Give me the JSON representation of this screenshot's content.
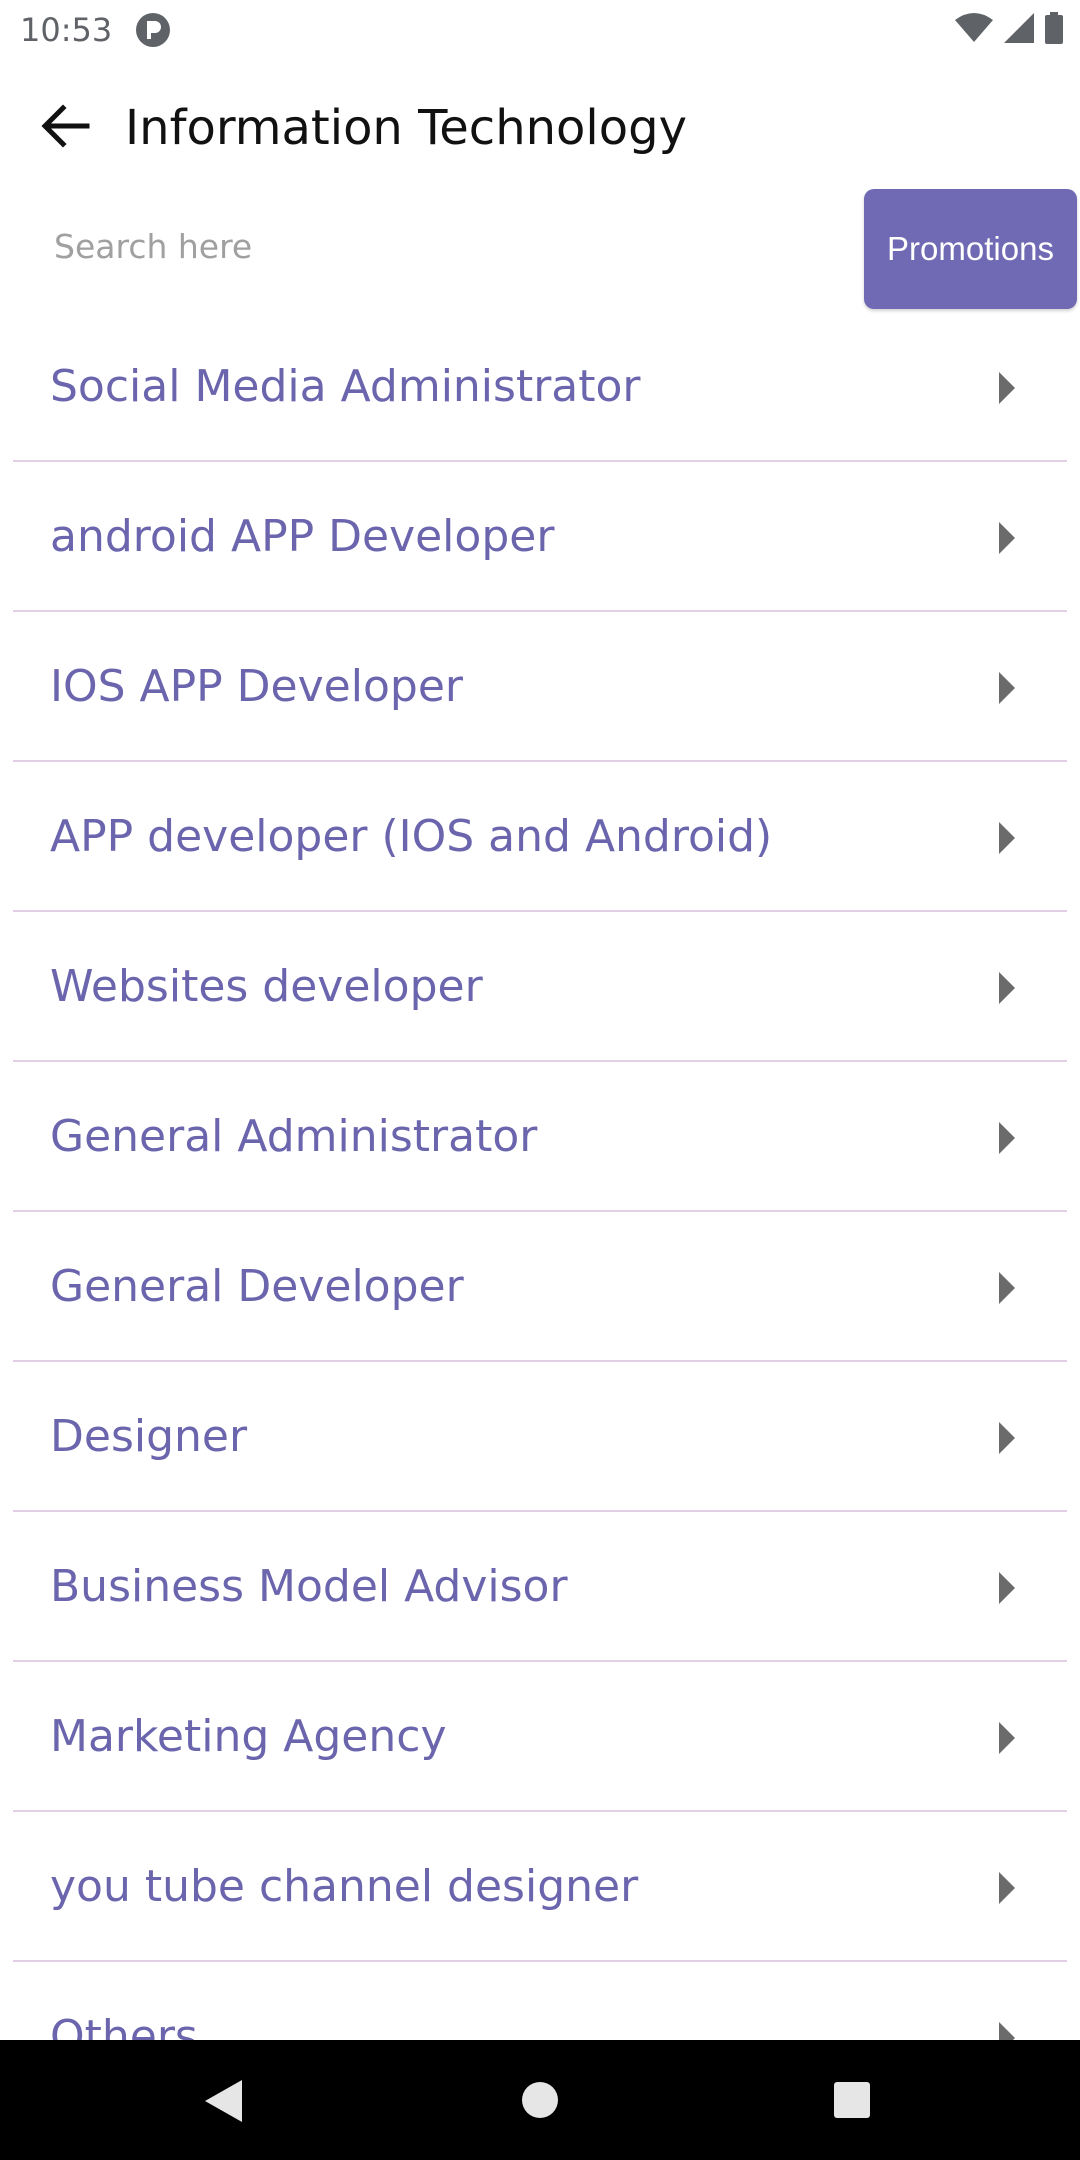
{
  "status_bar": {
    "time": "10:53",
    "app_icon": "circle-p-icon",
    "icons": [
      "wifi-icon",
      "signal-icon",
      "battery-icon"
    ]
  },
  "app_bar": {
    "title": "Information Technology",
    "back_icon": "arrow-back-icon"
  },
  "search": {
    "placeholder": "Search here",
    "value": ""
  },
  "promotions": {
    "label": "Promotions"
  },
  "list": {
    "items": [
      {
        "label": "Social Media Administrator"
      },
      {
        "label": "android APP Developer"
      },
      {
        "label": "IOS APP Developer"
      },
      {
        "label": "APP developer (IOS and Android)"
      },
      {
        "label": "Websites developer"
      },
      {
        "label": "General Administrator"
      },
      {
        "label": "General Developer"
      },
      {
        "label": "Designer"
      },
      {
        "label": "Business Model Advisor"
      },
      {
        "label": "Marketing Agency"
      },
      {
        "label": "you tube channel designer"
      },
      {
        "label": "Others"
      }
    ],
    "item_arrow_icon": "chevron-right-icon"
  },
  "nav_bar": {
    "back_icon": "nav-back-icon",
    "home_icon": "nav-home-icon",
    "recents_icon": "nav-recents-icon"
  },
  "colors": {
    "accent": "#6f6ab3",
    "item_text": "#6a65ad",
    "divider": "#e2cfe6"
  }
}
